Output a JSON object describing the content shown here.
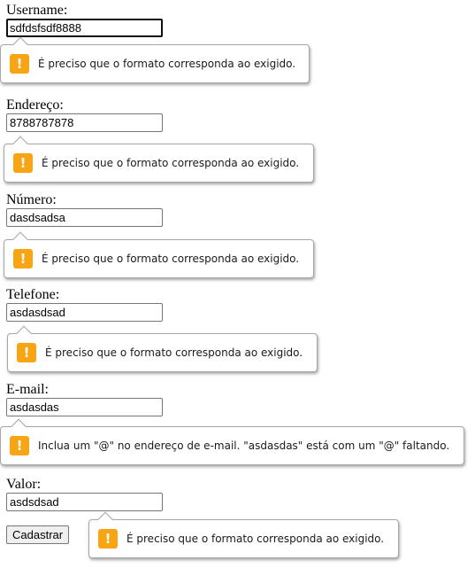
{
  "form": {
    "fields": [
      {
        "label": "Username:",
        "value": "sdfdsfsdf8888",
        "error": "É preciso que o formato corresponda ao exigido."
      },
      {
        "label": "Endereço:",
        "value": "8788787878",
        "error": "É preciso que o formato corresponda ao exigido."
      },
      {
        "label": "Número:",
        "value": "dasdsadsa",
        "error": "É preciso que o formato corresponda ao exigido."
      },
      {
        "label": "Telefone:",
        "value": "asdasdsad",
        "error": "É preciso que o formato corresponda ao exigido."
      },
      {
        "label": "E-mail:",
        "value": "asdasdas",
        "error": "Inclua um \"@\" no endereço de e-mail. \"asdasdas\" está com um \"@\" faltando."
      },
      {
        "label": "Valor:",
        "value": "asdsdsad",
        "error": "É preciso que o formato corresponda ao exigido."
      }
    ],
    "submit_label": "Cadastrar",
    "warning_icon": "exclamation-warning-icon",
    "warning_color": "#f8a513"
  }
}
